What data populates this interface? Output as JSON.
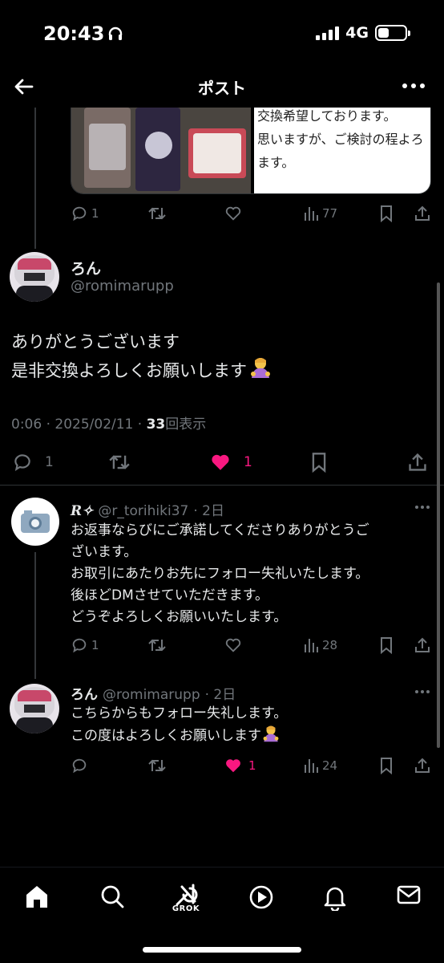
{
  "status_bar": {
    "time": "20:43",
    "network": "4G"
  },
  "header": {
    "title": "ポスト"
  },
  "prev_post": {
    "media_text_lines": [
      "交換希望しております。",
      "思いますが、ご検討の程よろ",
      "ます。"
    ],
    "reply_count": "1",
    "view_count": "77"
  },
  "main_post": {
    "display_name": "ろん",
    "handle": "@romimarupp",
    "text_line1": "ありがとうございます",
    "text_line2": "是非交換よろしくお願いします",
    "timestamp": "0:06 · 2025/02/11 · ",
    "views": "33",
    "views_label": "回表示",
    "reply_count": "1",
    "like_count": "1"
  },
  "replies": [
    {
      "display_name": "R✧",
      "handle": "@r_torihiki37",
      "time": "· 2日",
      "lines": [
        "お返事ならびにご承諾してくださりありがとうご",
        "ざいます。",
        "お取引にあたりお先にフォロー失礼いたします。",
        "後ほどDMさせていただきます。",
        "どうぞよろしくお願いいたします。"
      ],
      "reply_count": "1",
      "view_count": "28"
    },
    {
      "display_name": "ろん",
      "handle": "@romimarupp",
      "time": "· 2日",
      "lines": [
        "こちらからもフォロー失礼します。",
        "この度はよろしくお願いします"
      ],
      "like_count": "1",
      "view_count": "24"
    }
  ],
  "nav": {
    "grok_label": "GROK"
  },
  "colors": {
    "background": "#000000",
    "text": "#e7e9ea",
    "secondary": "#71767b",
    "like_pink": "#f91880",
    "divider": "#2f3336"
  },
  "icons": [
    "back-arrow-icon",
    "more-icon",
    "reply-icon",
    "retweet-icon",
    "like-icon",
    "views-icon",
    "bookmark-icon",
    "share-icon",
    "home-icon",
    "search-icon",
    "grok-icon",
    "video-icon",
    "bell-icon",
    "mail-icon"
  ]
}
